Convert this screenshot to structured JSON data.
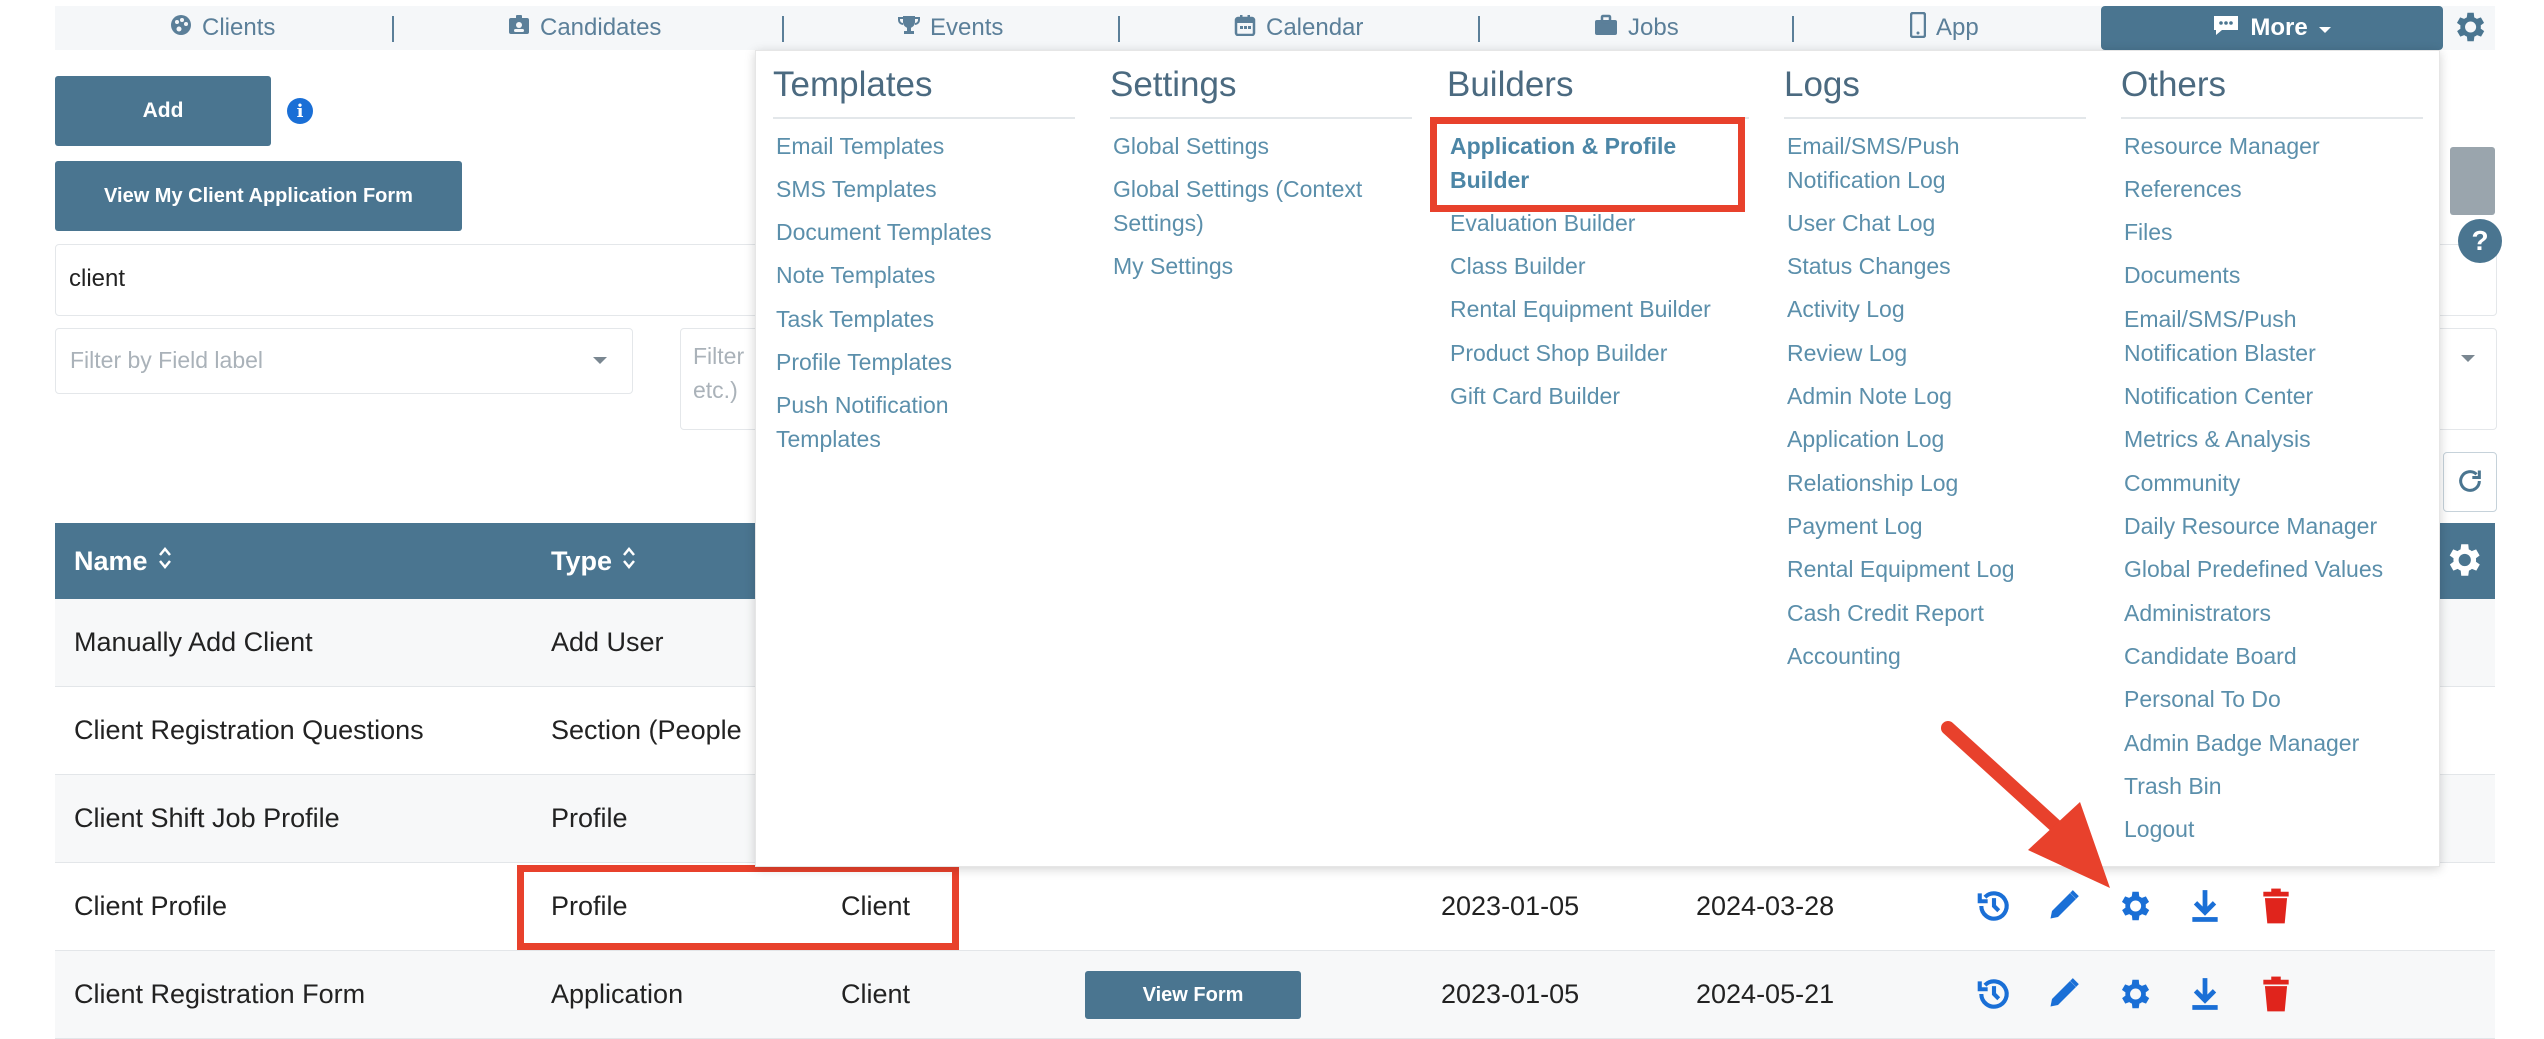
{
  "nav": {
    "items": [
      {
        "label": "Clients",
        "icon": "palette-icon"
      },
      {
        "label": "Candidates",
        "icon": "id-badge-icon"
      },
      {
        "label": "Events",
        "icon": "trophy-icon"
      },
      {
        "label": "Calendar",
        "icon": "calendar-icon"
      },
      {
        "label": "Jobs",
        "icon": "briefcase-icon"
      },
      {
        "label": "App",
        "icon": "mobile-icon"
      }
    ],
    "more": "More"
  },
  "toolbar": {
    "add": "Add",
    "view_form": "View My Client Application Form",
    "search_value": "client",
    "filter_field_placeholder": "Filter by Field label",
    "filter2_line1": "Filter",
    "filter2_line2": "etc.)"
  },
  "table": {
    "headers": {
      "name": "Name",
      "type": "Type"
    },
    "rows": [
      {
        "name": "Manually Add Client",
        "type": "Add User"
      },
      {
        "name": "Client Registration Questions",
        "type": "Section (People"
      },
      {
        "name": "Client Shift Job Profile",
        "type": "Profile"
      },
      {
        "name": "Client Profile",
        "type": "Profile",
        "target": "Client",
        "created": "2023-01-05",
        "updated": "2024-03-28"
      },
      {
        "name": "Client Registration Form",
        "type": "Application",
        "target": "Client",
        "view": "View Form",
        "created": "2023-01-05",
        "updated": "2024-05-21"
      }
    ]
  },
  "menu": {
    "templates": {
      "title": "Templates",
      "items": [
        "Email Templates",
        "SMS Templates",
        "Document Templates",
        "Note Templates",
        "Task Templates",
        "Profile Templates",
        "Push Notification Templates"
      ]
    },
    "settings": {
      "title": "Settings",
      "items": [
        "Global Settings",
        "Global Settings (Context Settings)",
        "My Settings"
      ]
    },
    "builders": {
      "title": "Builders",
      "items": [
        "Application & Profile Builder",
        "Evaluation Builder",
        "Class Builder",
        "Rental Equipment Builder",
        "Product Shop Builder",
        "Gift Card Builder"
      ]
    },
    "logs": {
      "title": "Logs",
      "items": [
        "Email/SMS/Push Notification Log",
        "User Chat Log",
        "Status Changes",
        "Activity Log",
        "Review Log",
        "Admin Note Log",
        "Application Log",
        "Relationship Log",
        "Payment Log",
        "Rental Equipment Log",
        "Cash Credit Report",
        "Accounting"
      ]
    },
    "others": {
      "title": "Others",
      "items": [
        "Resource Manager",
        "References",
        "Files",
        "Documents",
        "Email/SMS/Push Notification Blaster",
        "Notification Center",
        "Metrics & Analysis",
        "Community",
        "Daily Resource Manager",
        "Global Predefined Values",
        "Administrators",
        "Candidate Board",
        "Personal To Do",
        "Admin Badge Manager",
        "Trash Bin",
        "Logout"
      ]
    }
  },
  "colors": {
    "primary": "#4a7590",
    "link": "#5b8fab",
    "highlight": "#e8412c",
    "action_blue": "#1a6fd6",
    "delete_red": "#e0241c"
  }
}
